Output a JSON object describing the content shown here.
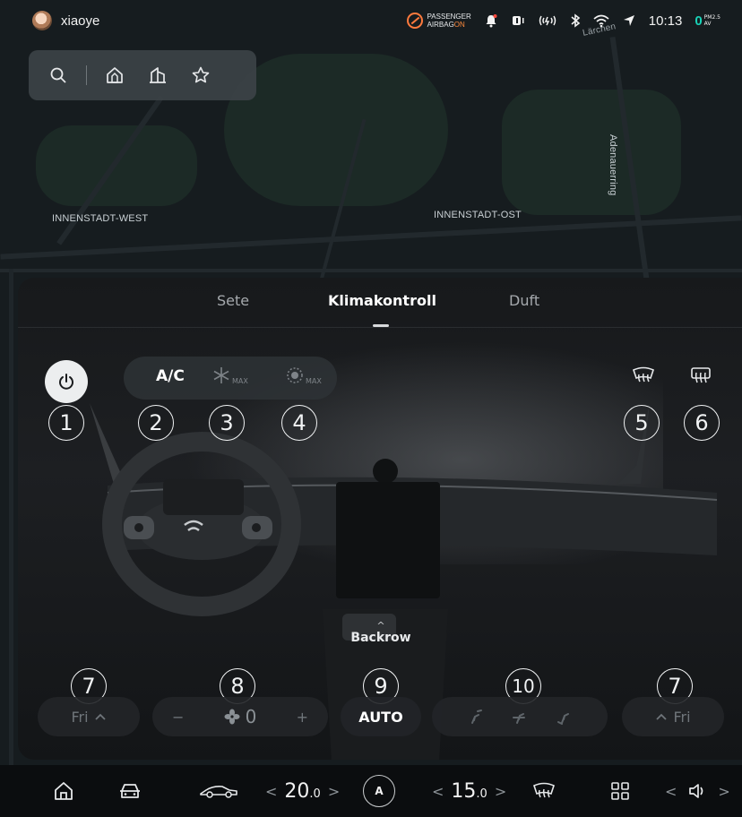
{
  "status_bar": {
    "username": "xiaoye",
    "airbag_line1": "PASSENGER",
    "airbag_line2": "AIRBAG",
    "airbag_state": "ON",
    "clock": "10:13",
    "pm_value": "0",
    "pm_label_1": "PM2.5",
    "pm_label_2": "AV",
    "icons": [
      "bell-icon",
      "seatbelt-icon",
      "connectivity-icon",
      "bluetooth-icon",
      "wifi-icon",
      "navigation-arrow-icon"
    ]
  },
  "map": {
    "labels": {
      "innenstadt_west": "INNENSTADT-WEST",
      "innenstadt_ost": "INNENSTADT-OST",
      "adenauerring": "Adenauerring",
      "larchen": "Lärchen"
    }
  },
  "map_toolbar": {
    "icons": [
      "search-icon",
      "home-icon",
      "work-icon",
      "favorites-icon"
    ]
  },
  "climate": {
    "tabs": [
      "Sete",
      "Klimakontroll",
      "Duft"
    ],
    "active_tab": "Klimakontroll",
    "ac_label": "A/C",
    "max_cool_label": "MAX",
    "max_heat_label": "MAX",
    "backrow_label": "Backrow",
    "left_mode": "Fri",
    "right_mode": "Fri",
    "fan_speed": "0",
    "fan_minus": "−",
    "fan_plus": "+",
    "auto_label": "AUTO",
    "markers": {
      "m1": "1",
      "m2": "2",
      "m3": "3",
      "m4": "4",
      "m5": "5",
      "m6": "6",
      "m7a": "7",
      "m8": "8",
      "m9": "9",
      "m10": "10",
      "m7b": "7"
    }
  },
  "dock": {
    "driver_temp_int": "20",
    "driver_temp_dec": ".0",
    "passenger_temp_int": "15",
    "passenger_temp_dec": ".0",
    "auto_button": "A",
    "arrow_left": "<",
    "arrow_right": ">"
  }
}
